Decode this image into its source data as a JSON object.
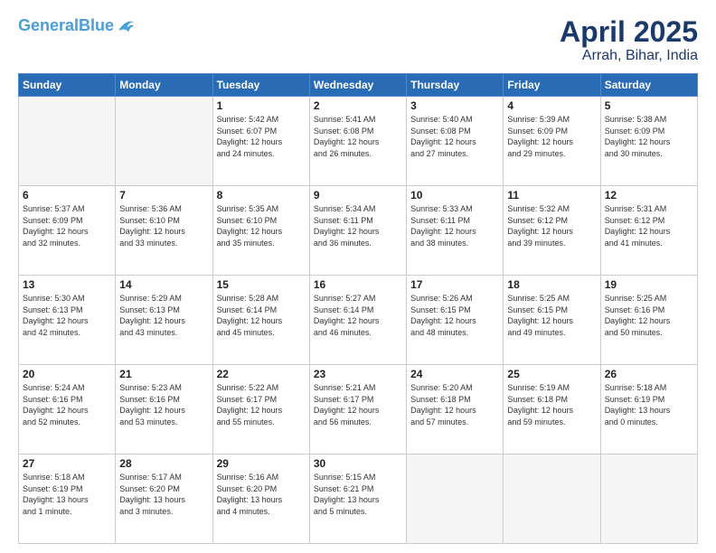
{
  "header": {
    "logo_line1": "General",
    "logo_line2": "Blue",
    "main_title": "April 2025",
    "sub_title": "Arrah, Bihar, India"
  },
  "weekdays": [
    "Sunday",
    "Monday",
    "Tuesday",
    "Wednesday",
    "Thursday",
    "Friday",
    "Saturday"
  ],
  "weeks": [
    [
      {
        "num": "",
        "info": ""
      },
      {
        "num": "",
        "info": ""
      },
      {
        "num": "1",
        "info": "Sunrise: 5:42 AM\nSunset: 6:07 PM\nDaylight: 12 hours\nand 24 minutes."
      },
      {
        "num": "2",
        "info": "Sunrise: 5:41 AM\nSunset: 6:08 PM\nDaylight: 12 hours\nand 26 minutes."
      },
      {
        "num": "3",
        "info": "Sunrise: 5:40 AM\nSunset: 6:08 PM\nDaylight: 12 hours\nand 27 minutes."
      },
      {
        "num": "4",
        "info": "Sunrise: 5:39 AM\nSunset: 6:09 PM\nDaylight: 12 hours\nand 29 minutes."
      },
      {
        "num": "5",
        "info": "Sunrise: 5:38 AM\nSunset: 6:09 PM\nDaylight: 12 hours\nand 30 minutes."
      }
    ],
    [
      {
        "num": "6",
        "info": "Sunrise: 5:37 AM\nSunset: 6:09 PM\nDaylight: 12 hours\nand 32 minutes."
      },
      {
        "num": "7",
        "info": "Sunrise: 5:36 AM\nSunset: 6:10 PM\nDaylight: 12 hours\nand 33 minutes."
      },
      {
        "num": "8",
        "info": "Sunrise: 5:35 AM\nSunset: 6:10 PM\nDaylight: 12 hours\nand 35 minutes."
      },
      {
        "num": "9",
        "info": "Sunrise: 5:34 AM\nSunset: 6:11 PM\nDaylight: 12 hours\nand 36 minutes."
      },
      {
        "num": "10",
        "info": "Sunrise: 5:33 AM\nSunset: 6:11 PM\nDaylight: 12 hours\nand 38 minutes."
      },
      {
        "num": "11",
        "info": "Sunrise: 5:32 AM\nSunset: 6:12 PM\nDaylight: 12 hours\nand 39 minutes."
      },
      {
        "num": "12",
        "info": "Sunrise: 5:31 AM\nSunset: 6:12 PM\nDaylight: 12 hours\nand 41 minutes."
      }
    ],
    [
      {
        "num": "13",
        "info": "Sunrise: 5:30 AM\nSunset: 6:13 PM\nDaylight: 12 hours\nand 42 minutes."
      },
      {
        "num": "14",
        "info": "Sunrise: 5:29 AM\nSunset: 6:13 PM\nDaylight: 12 hours\nand 43 minutes."
      },
      {
        "num": "15",
        "info": "Sunrise: 5:28 AM\nSunset: 6:14 PM\nDaylight: 12 hours\nand 45 minutes."
      },
      {
        "num": "16",
        "info": "Sunrise: 5:27 AM\nSunset: 6:14 PM\nDaylight: 12 hours\nand 46 minutes."
      },
      {
        "num": "17",
        "info": "Sunrise: 5:26 AM\nSunset: 6:15 PM\nDaylight: 12 hours\nand 48 minutes."
      },
      {
        "num": "18",
        "info": "Sunrise: 5:25 AM\nSunset: 6:15 PM\nDaylight: 12 hours\nand 49 minutes."
      },
      {
        "num": "19",
        "info": "Sunrise: 5:25 AM\nSunset: 6:16 PM\nDaylight: 12 hours\nand 50 minutes."
      }
    ],
    [
      {
        "num": "20",
        "info": "Sunrise: 5:24 AM\nSunset: 6:16 PM\nDaylight: 12 hours\nand 52 minutes."
      },
      {
        "num": "21",
        "info": "Sunrise: 5:23 AM\nSunset: 6:16 PM\nDaylight: 12 hours\nand 53 minutes."
      },
      {
        "num": "22",
        "info": "Sunrise: 5:22 AM\nSunset: 6:17 PM\nDaylight: 12 hours\nand 55 minutes."
      },
      {
        "num": "23",
        "info": "Sunrise: 5:21 AM\nSunset: 6:17 PM\nDaylight: 12 hours\nand 56 minutes."
      },
      {
        "num": "24",
        "info": "Sunrise: 5:20 AM\nSunset: 6:18 PM\nDaylight: 12 hours\nand 57 minutes."
      },
      {
        "num": "25",
        "info": "Sunrise: 5:19 AM\nSunset: 6:18 PM\nDaylight: 12 hours\nand 59 minutes."
      },
      {
        "num": "26",
        "info": "Sunrise: 5:18 AM\nSunset: 6:19 PM\nDaylight: 13 hours\nand 0 minutes."
      }
    ],
    [
      {
        "num": "27",
        "info": "Sunrise: 5:18 AM\nSunset: 6:19 PM\nDaylight: 13 hours\nand 1 minute."
      },
      {
        "num": "28",
        "info": "Sunrise: 5:17 AM\nSunset: 6:20 PM\nDaylight: 13 hours\nand 3 minutes."
      },
      {
        "num": "29",
        "info": "Sunrise: 5:16 AM\nSunset: 6:20 PM\nDaylight: 13 hours\nand 4 minutes."
      },
      {
        "num": "30",
        "info": "Sunrise: 5:15 AM\nSunset: 6:21 PM\nDaylight: 13 hours\nand 5 minutes."
      },
      {
        "num": "",
        "info": ""
      },
      {
        "num": "",
        "info": ""
      },
      {
        "num": "",
        "info": ""
      }
    ]
  ]
}
